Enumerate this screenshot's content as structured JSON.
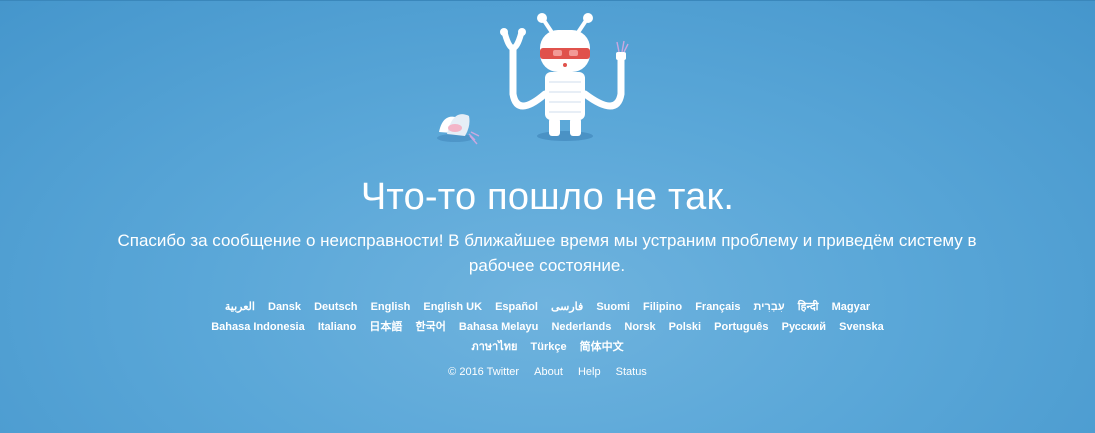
{
  "page": {
    "headline": "Что-то пошло не так.",
    "message": "Спасибо за сообщение о неисправности! В ближайшее время мы устраним проблему и приведём систему в рабочее состояние."
  },
  "illustration": {
    "icon": "broken-robot-icon",
    "colors": {
      "body": "#ffffff",
      "visor": "#e0524c",
      "shadow": "#3b7fb4"
    }
  },
  "languages": {
    "row1": [
      "العربية",
      "Dansk",
      "Deutsch",
      "English",
      "English UK",
      "Español",
      "فارسی",
      "Suomi",
      "Filipino",
      "Français",
      "עִבְרִית",
      "हिन्दी",
      "Magyar"
    ],
    "row2": [
      "Bahasa Indonesia",
      "Italiano",
      "日本語",
      "한국어",
      "Bahasa Melayu",
      "Nederlands",
      "Norsk",
      "Polski",
      "Português",
      "Русский",
      "Svenska"
    ],
    "row3": [
      "ภาษาไทย",
      "Türkçe",
      "简体中文"
    ]
  },
  "footer": {
    "copyright": "© 2016 Twitter",
    "about": "About",
    "help": "Help",
    "status": "Status"
  }
}
